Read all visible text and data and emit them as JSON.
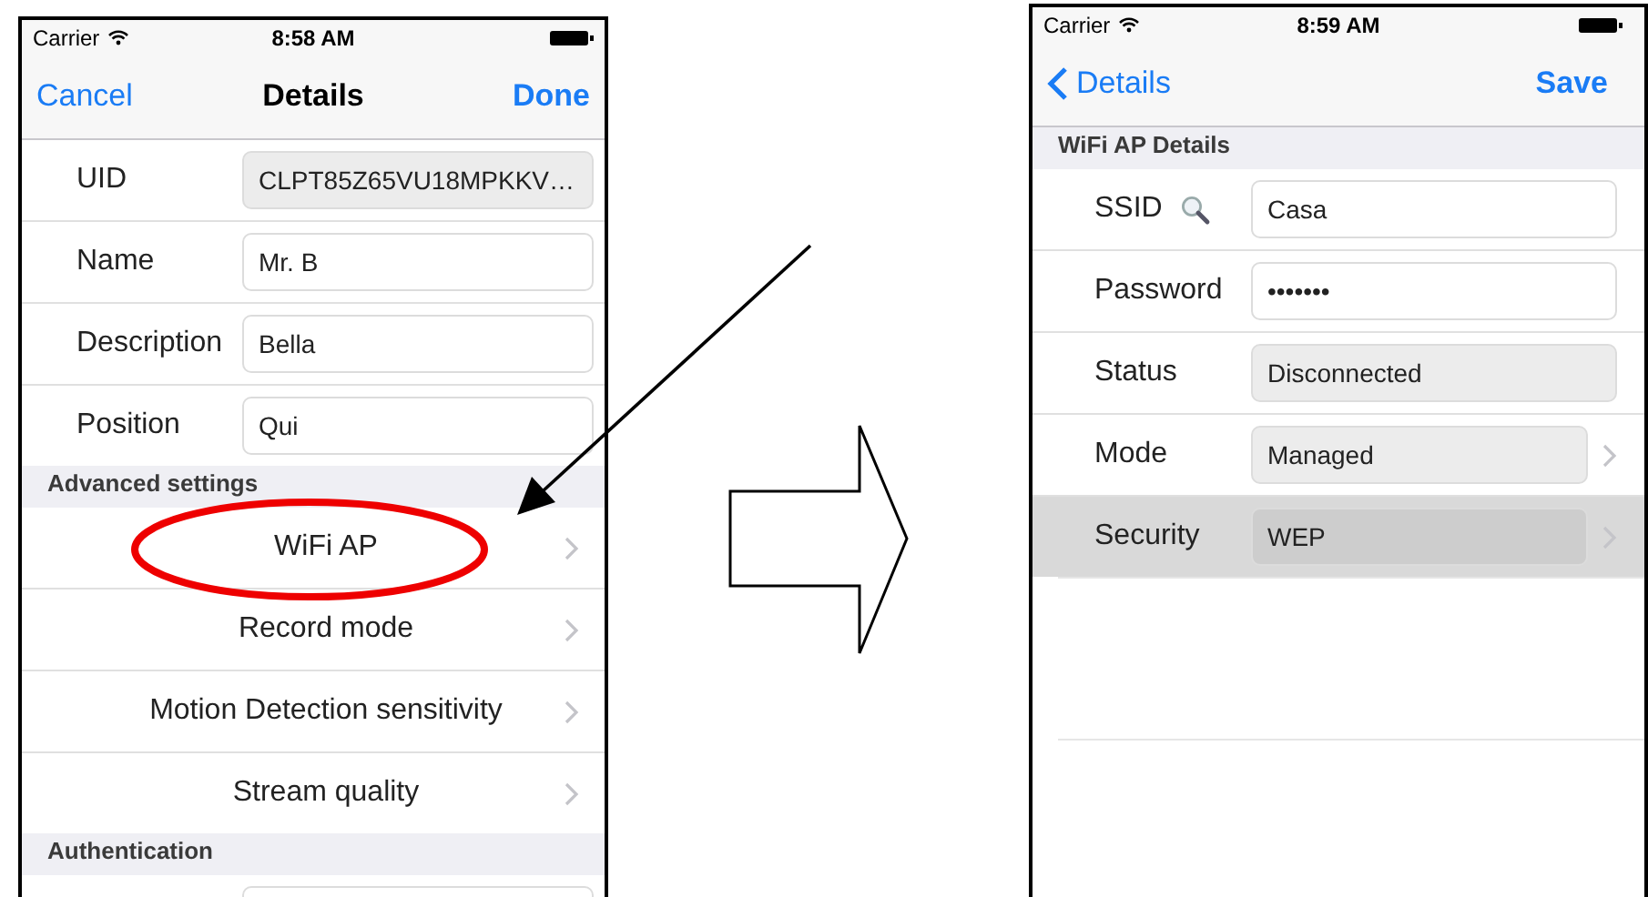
{
  "screens": [
    {
      "status_bar": {
        "carrier": "Carrier",
        "time": "8:58 AM"
      },
      "nav": {
        "left": "Cancel",
        "back": false,
        "title": "Details",
        "right": "Done"
      },
      "sections": [
        {
          "rows": [
            {
              "kind": "field",
              "label": "UID",
              "value": "CLPT85Z65VU18MPKKV…",
              "editable": false,
              "chevron": false,
              "selected": false
            },
            {
              "kind": "field",
              "label": "Name",
              "value": "Mr. B",
              "editable": true,
              "chevron": false,
              "selected": false
            },
            {
              "kind": "field",
              "label": "Description",
              "value": "Bella",
              "editable": true,
              "chevron": false,
              "selected": false
            },
            {
              "kind": "field",
              "label": "Position",
              "value": "Qui",
              "editable": true,
              "chevron": false,
              "selected": false
            }
          ]
        },
        {
          "header": "Advanced settings",
          "rows": [
            {
              "kind": "link",
              "label": "WiFi AP",
              "selected": false
            },
            {
              "kind": "link",
              "label": "Record mode",
              "selected": false
            },
            {
              "kind": "link",
              "label": "Motion Detection sensitivity",
              "selected": false
            },
            {
              "kind": "link",
              "label": "Stream quality",
              "selected": false
            }
          ]
        },
        {
          "header": "Authentication",
          "rows": [
            {
              "kind": "field",
              "editable": true,
              "chevron": false,
              "selected": false
            }
          ]
        }
      ]
    },
    {
      "status_bar": {
        "carrier": "Carrier",
        "time": "8:59 AM"
      },
      "nav": {
        "left": "Details",
        "back": true,
        "right": "Save"
      },
      "sections": [
        {
          "header": "WiFi AP Details",
          "rows": [
            {
              "kind": "search-field",
              "label": "SSID",
              "value": "Casa",
              "editable": true,
              "chevron": false,
              "selected": false
            },
            {
              "kind": "field",
              "label": "Password",
              "value": "•••••••",
              "editable": true,
              "chevron": false,
              "selected": false
            },
            {
              "kind": "field",
              "label": "Status",
              "value": "Disconnected",
              "editable": false,
              "chevron": false,
              "selected": false
            },
            {
              "kind": "field",
              "label": "Mode",
              "value": "Managed",
              "editable": false,
              "chevron": true,
              "selected": false
            },
            {
              "kind": "field",
              "label": "Security",
              "value": "WEP",
              "editable": false,
              "chevron": true,
              "selected": true
            }
          ]
        }
      ]
    }
  ]
}
